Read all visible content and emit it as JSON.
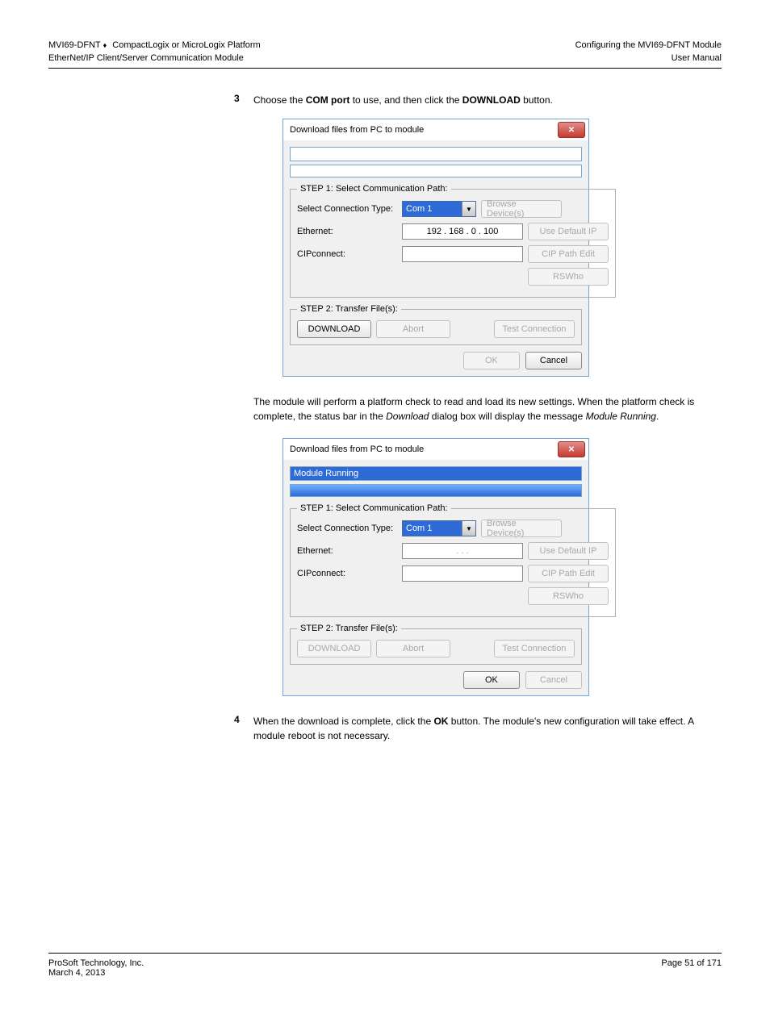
{
  "header": {
    "product_line1": "MVI69-DFNT ",
    "product_line1_link": "CompactLogix or MicroLogix Platform",
    "product_line2": "EtherNet/IP Client/Server Communication Module",
    "right_line1": "Configuring the MVI69-DFNT Module",
    "right_line2": "User Manual"
  },
  "steps": {
    "s3_num": "3",
    "s3_text": "Choose the ",
    "s3_bold": "COM port",
    "s3_text2": " to use, and then click the ",
    "s3_btn": "DOWNLOAD",
    "s3_text3": " button.",
    "s3_after": "The module will perform a platform check to read and load its new settings. When the platform check is complete, the status bar in the ",
    "s3_after_i": "Download",
    "s3_after2": " dialog box will display the message ",
    "s3_after_i2": "Module Running",
    "s3_after3": ".",
    "s4_num": "4",
    "s4_txt1_pre": "When the download is complete, click the ",
    "s4_txt1_btn": "OK",
    "s4_txt1_post": " button. The module's new configuration will take effect. A module reboot is not necessary."
  },
  "dialog1": {
    "title": "Download files from PC to module",
    "status1": "",
    "progress_pct": 0,
    "step1_legend": "STEP 1: Select Communication Path:",
    "sel_conn_label": "Select Connection Type:",
    "combo_val": "Com 1",
    "browse": "Browse Device(s)",
    "eth_label": "Ethernet:",
    "ip": "192  .  168  .    0  .  100",
    "use_default": "Use Default IP",
    "cip_label": "CIPconnect:",
    "cip_edit": "CIP Path Edit",
    "rswho": "RSWho",
    "step2_legend": "STEP 2: Transfer File(s):",
    "download": "DOWNLOAD",
    "abort": "Abort",
    "test": "Test Connection",
    "ok": "OK",
    "cancel": "Cancel"
  },
  "dialog2": {
    "title": "Download files from PC to module",
    "status1": "Module Running",
    "progress_pct": 100,
    "step1_legend": "STEP 1: Select Communication Path:",
    "sel_conn_label": "Select Connection Type:",
    "combo_val": "Com 1",
    "browse": "Browse Device(s)",
    "eth_label": "Ethernet:",
    "ip": "  .        .        .  ",
    "use_default": "Use Default IP",
    "cip_label": "CIPconnect:",
    "cip_edit": "CIP Path Edit",
    "rswho": "RSWho",
    "step2_legend": "STEP 2: Transfer File(s):",
    "download": "DOWNLOAD",
    "abort": "Abort",
    "test": "Test Connection",
    "ok": "OK",
    "cancel": "Cancel"
  },
  "footer": {
    "company": "ProSoft Technology, Inc.",
    "date": "March 4, 2013",
    "page": "Page 51 of 171"
  }
}
